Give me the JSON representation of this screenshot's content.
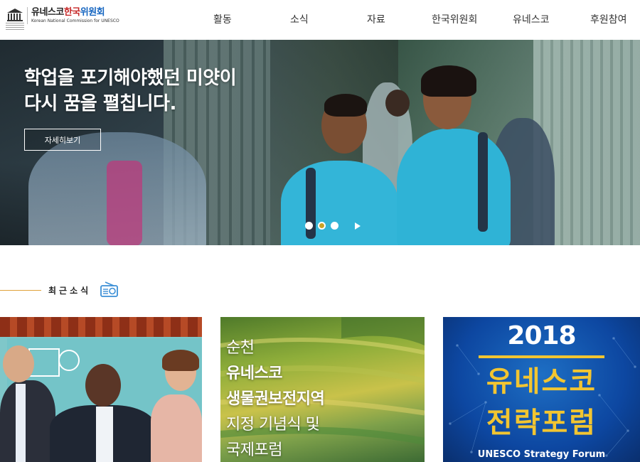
{
  "logo": {
    "ko_part1": "유네스코",
    "ko_part2": "한국",
    "ko_part3": "위원회",
    "en": "Korean National Commission for UNESCO",
    "emblem_icon": "unesco-temple-icon"
  },
  "nav": {
    "items": [
      {
        "label": "활동"
      },
      {
        "label": "소식"
      },
      {
        "label": "자료"
      },
      {
        "label": "한국위원회"
      },
      {
        "label": "유네스코"
      },
      {
        "label": "후원참여"
      }
    ]
  },
  "hero": {
    "title_line1": "학업을 포기해야했던 미얏이",
    "title_line2": "다시 꿈을 펼칩니다.",
    "button_label": "자세히보기",
    "slides_total": 3,
    "active_slide": 2,
    "play_icon": "play-icon"
  },
  "section": {
    "title": "최근소식",
    "icon": "radio-icon",
    "accent_color": "#e0a23a"
  },
  "cards": [
    {
      "name": "news-card-1"
    },
    {
      "name": "news-card-2",
      "lines": [
        "순천",
        "유네스코",
        "생물권보전지역",
        "지정 기념식 및",
        "국제포럼"
      ]
    },
    {
      "name": "news-card-3",
      "year": "2018",
      "title_line1": "유네스코",
      "title_line2": "전략포럼",
      "subtitle": "UNESCO Strategy Forum"
    }
  ]
}
